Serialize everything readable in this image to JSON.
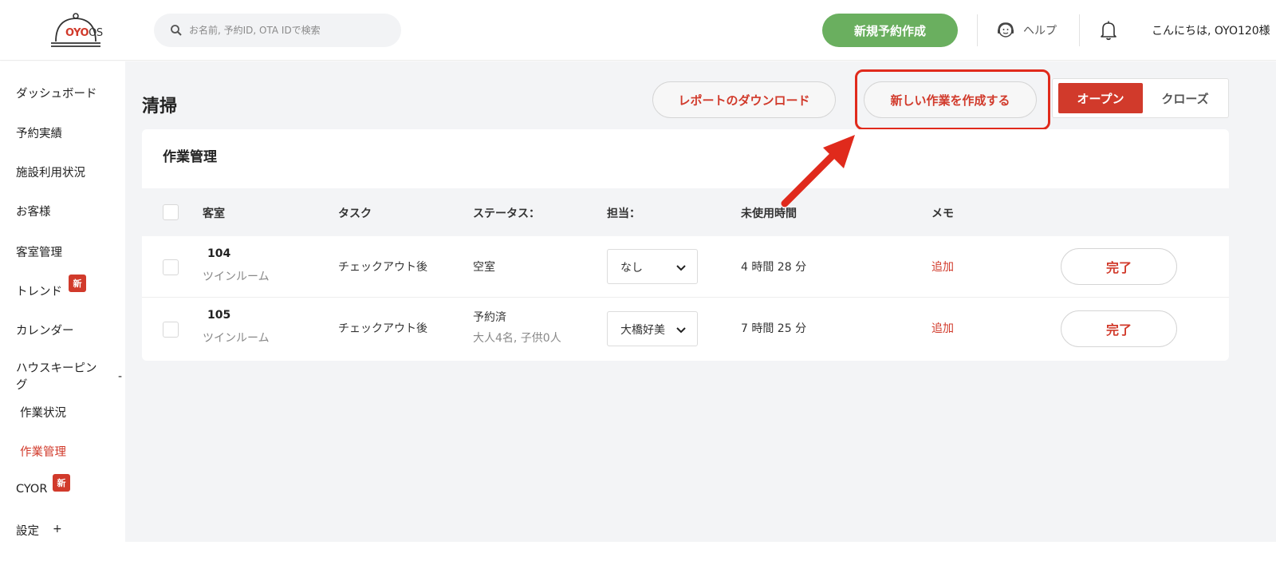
{
  "header": {
    "logo": {
      "brand": "OYO",
      "suffix": "OS"
    },
    "search_placeholder": "お名前, 予約ID, OTA IDで検索",
    "new_booking_label": "新規予約作成",
    "help_label": "ヘルプ",
    "greeting": "こんにちは, OYO120様"
  },
  "sidebar": {
    "items": [
      {
        "label": "ダッシュボード"
      },
      {
        "label": "予約実績"
      },
      {
        "label": "施設利用状況"
      },
      {
        "label": "お客様"
      },
      {
        "label": "客室管理"
      },
      {
        "label": "トレンド",
        "badge": "新"
      },
      {
        "label": "カレンダー"
      },
      {
        "label": "ハウスキーピング",
        "expanded_sign": "-"
      },
      {
        "label": "CYOR",
        "badge": "新"
      },
      {
        "label": "設定",
        "expanded_sign": "+"
      }
    ],
    "housekeeping_line1": "ハウスキーピン",
    "housekeeping_line2": "グ",
    "subitems": [
      {
        "label": "作業状況",
        "active": false
      },
      {
        "label": "作業管理",
        "active": true
      }
    ]
  },
  "page": {
    "title": "清掃",
    "download_report_label": "レポートのダウンロード",
    "create_task_label": "新しい作業を作成する",
    "toggle": {
      "open_label": "オープン",
      "close_label": "クローズ",
      "selected": "オープン"
    }
  },
  "card": {
    "title": "作業管理",
    "columns": [
      "客室",
      "タスク",
      "ステータス：",
      "担当：",
      "未使用時間",
      "メモ"
    ],
    "rows": [
      {
        "room": "104",
        "room_type": "ツインルーム",
        "task": "チェックアウト後",
        "status": "空室",
        "status_detail": "",
        "assignee": "なし",
        "unused_time": "4 時間 28 分",
        "memo": "追加",
        "action": "完了"
      },
      {
        "room": "105",
        "room_type": "ツインルーム",
        "task": "チェックアウト後",
        "status": "予約済",
        "status_detail": "大人4名, 子供0人",
        "assignee": "大橋好美",
        "unused_time": "7 時間 25 分",
        "memo": "追加",
        "action": "完了"
      }
    ]
  },
  "colors": {
    "brand_red": "#d13a2b",
    "green": "#6aaf5f",
    "annotation_red": "#e02a1c",
    "background": "#f3f4f6"
  }
}
